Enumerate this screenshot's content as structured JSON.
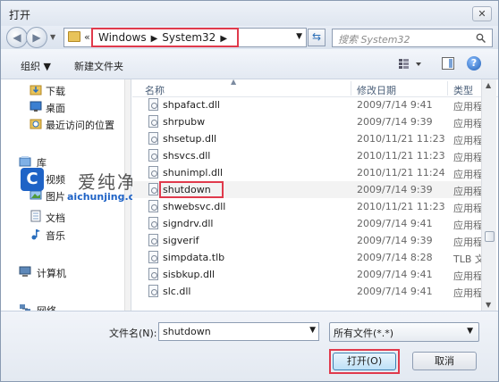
{
  "window": {
    "title": "打开",
    "close_label": "✕"
  },
  "address": {
    "path": [
      "Windows",
      "System32"
    ],
    "search_placeholder": "搜索 System32"
  },
  "toolbar": {
    "organize": "组织 ▼",
    "new_folder": "新建文件夹"
  },
  "nav": {
    "items": [
      {
        "label": "下载",
        "icon": "download-folder-icon"
      },
      {
        "label": "桌面",
        "icon": "desktop-icon"
      },
      {
        "label": "最近访问的位置",
        "icon": "recent-places-icon"
      },
      {
        "label": "库",
        "icon": "library-icon"
      },
      {
        "label": "视频",
        "icon": "video-library-icon"
      },
      {
        "label": "图片",
        "icon": "pictures-library-icon"
      },
      {
        "label": "文档",
        "icon": "documents-library-icon"
      },
      {
        "label": "音乐",
        "icon": "music-library-icon"
      },
      {
        "label": "计算机",
        "icon": "computer-icon"
      },
      {
        "label": "网络",
        "icon": "network-icon"
      }
    ]
  },
  "watermark": {
    "text": "爱纯净",
    "url": "aichunjing.com",
    "logo_letter": "C"
  },
  "columns": {
    "name": "名称",
    "date": "修改日期",
    "type": "类型"
  },
  "files": [
    {
      "name": "shpafact.dll",
      "date": "2009/7/14 9:41",
      "type": "应用程"
    },
    {
      "name": "shrpubw",
      "date": "2009/7/14 9:39",
      "type": "应用程"
    },
    {
      "name": "shsetup.dll",
      "date": "2010/11/21 11:23",
      "type": "应用程"
    },
    {
      "name": "shsvcs.dll",
      "date": "2010/11/21 11:23",
      "type": "应用程"
    },
    {
      "name": "shunimpl.dll",
      "date": "2010/11/21 11:24",
      "type": "应用程"
    },
    {
      "name": "shutdown",
      "date": "2009/7/14 9:39",
      "type": "应用程"
    },
    {
      "name": "shwebsvc.dll",
      "date": "2010/11/21 11:23",
      "type": "应用程"
    },
    {
      "name": "signdrv.dll",
      "date": "2009/7/14 9:41",
      "type": "应用程"
    },
    {
      "name": "sigverif",
      "date": "2009/7/14 9:39",
      "type": "应用程"
    },
    {
      "name": "simpdata.tlb",
      "date": "2009/7/14 8:28",
      "type": "TLB 文"
    },
    {
      "name": "sisbkup.dll",
      "date": "2009/7/14 9:41",
      "type": "应用程"
    },
    {
      "name": "slc.dll",
      "date": "2009/7/14 9:41",
      "type": "应用程"
    }
  ],
  "bottom": {
    "filename_label": "文件名(N):",
    "filename_value": "shutdown",
    "filetype_value": "所有文件(*.*)",
    "open_label": "打开(O)",
    "cancel_label": "取消"
  },
  "colors": {
    "highlight": "#e03a4c",
    "accent": "#1f63c6"
  }
}
